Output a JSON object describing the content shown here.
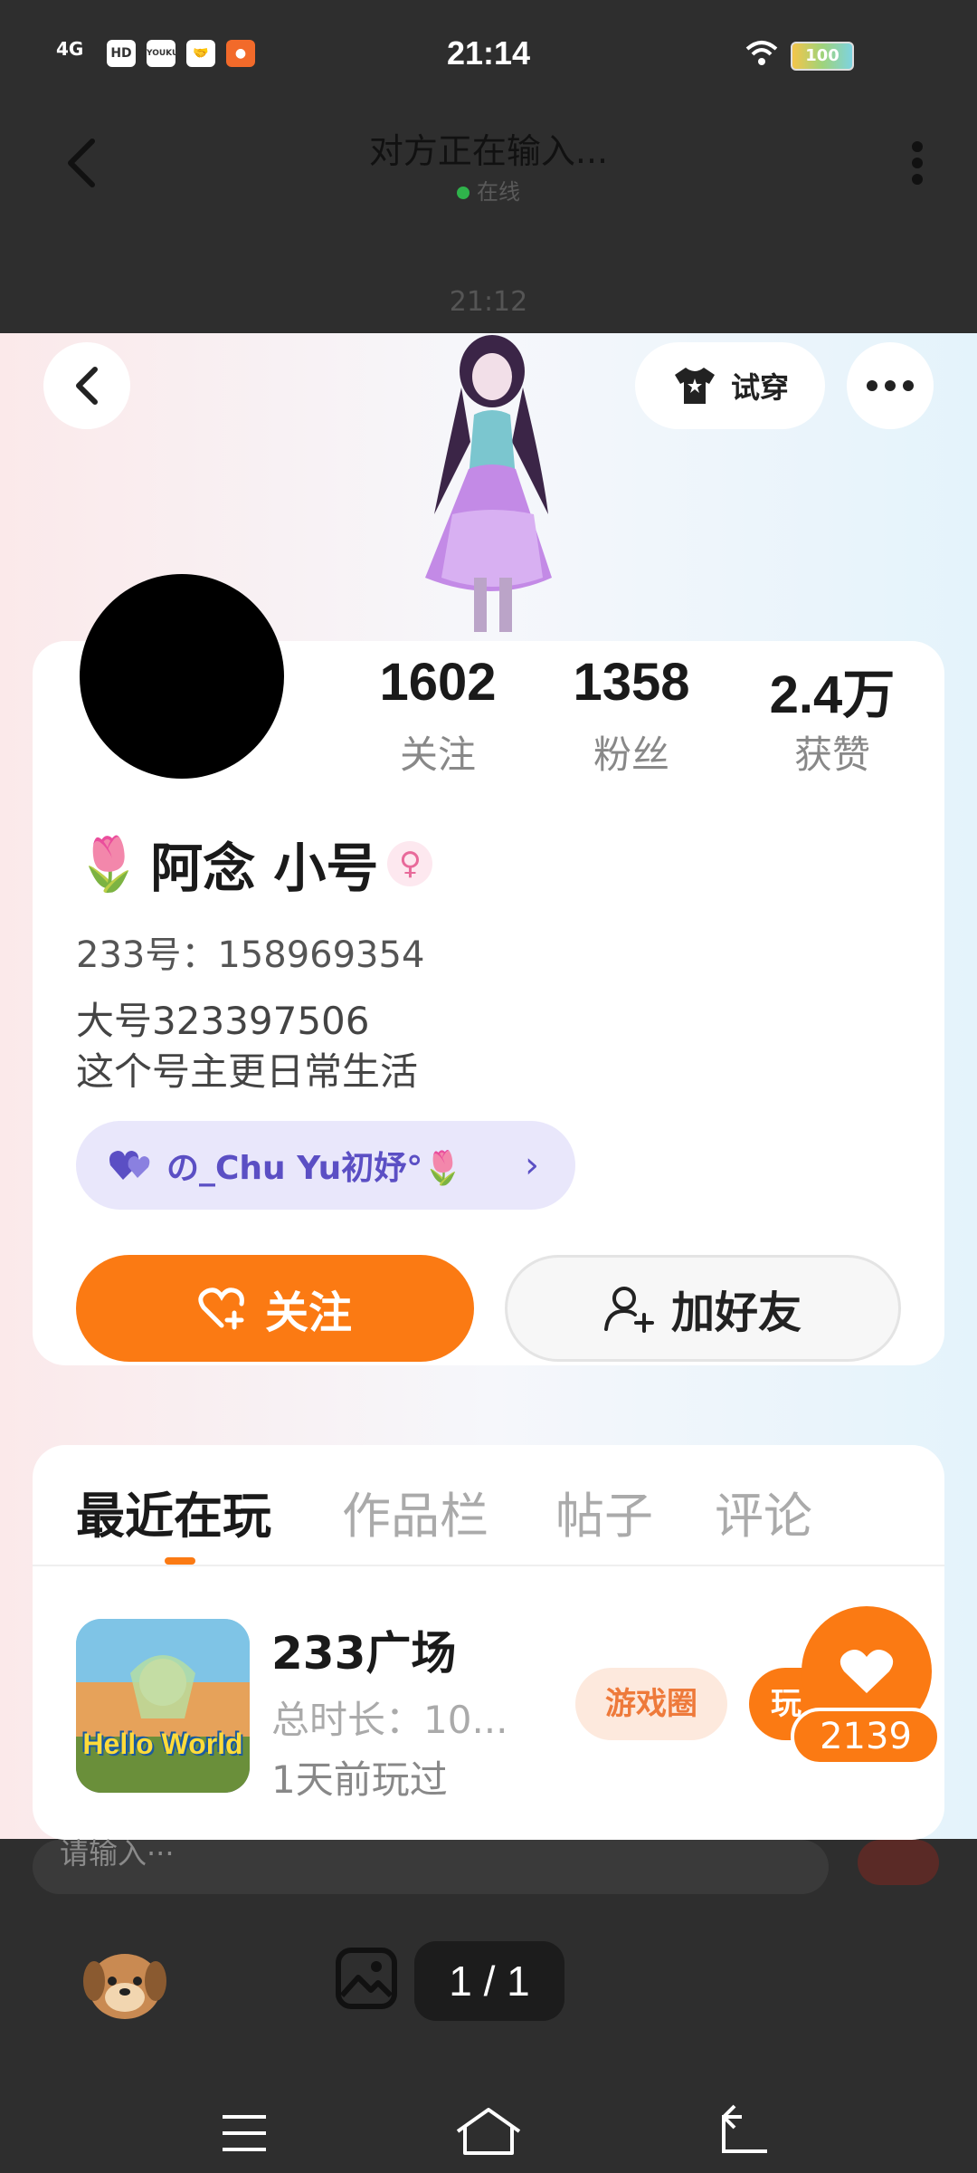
{
  "status_bar": {
    "time": "21:14",
    "signal": "4G",
    "mini_icons": [
      "HD",
      "YOUKU",
      "",
      ""
    ],
    "battery": "100"
  },
  "chat_header": {
    "title": "对方正在输入...",
    "status": "在线"
  },
  "chat_time": "21:12",
  "profile": {
    "try_on_label": "试穿",
    "stats": [
      {
        "value": "1602",
        "label": "关注"
      },
      {
        "value": "1358",
        "label": "粉丝"
      },
      {
        "value": "2.4万",
        "label": "获赞"
      }
    ],
    "name_prefix_emoji": "🌷",
    "name": "阿念 小号",
    "gender_symbol": "♀",
    "id_line": "233号：158969354",
    "bio_line1": "大号323397506",
    "bio_line2": "这个号主更日常生活",
    "link_chip_text": "の_Chu Yu初妤°🌷",
    "follow_label": "关注",
    "add_friend_label": "加好友"
  },
  "tabs": [
    "最近在玩",
    "作品栏",
    "帖子",
    "评论"
  ],
  "game": {
    "thumb_text": "Hello World",
    "title": "233广场",
    "duration": "总时长：10...",
    "last_played": "1天前玩过",
    "circle_tag": "游戏圈",
    "play_tag": "玩"
  },
  "likes": "2139",
  "chat_bottom": {
    "input_placeholder": "请输入···",
    "page_indicator": "1 / 1"
  },
  "colors": {
    "accent": "#fb7a13",
    "link_chip_bg": "#e9e7fb",
    "link_chip_text": "#5b4fc4",
    "dark_bg": "#2e2e2e"
  }
}
